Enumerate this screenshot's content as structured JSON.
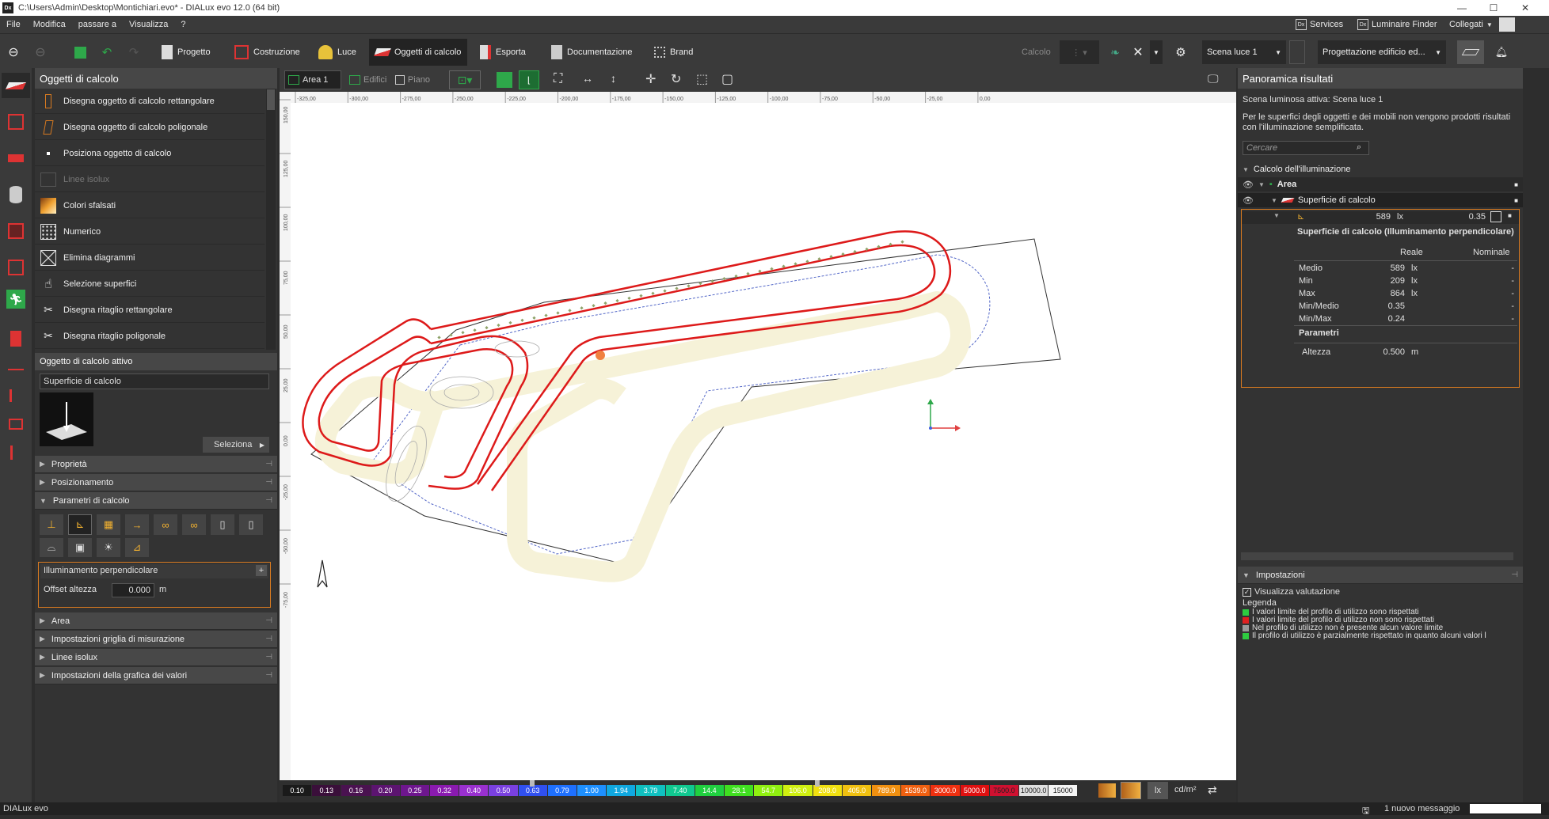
{
  "titlebar": {
    "app_icon": "Dx",
    "title": "C:\\Users\\Admin\\Desktop\\Montichiari.evo* - DIALux evo 12.0  (64 bit)",
    "minimize": "—",
    "maximize": "☐",
    "close": "✕"
  },
  "menu": {
    "items": [
      "File",
      "Modifica",
      "passare a",
      "Visualizza",
      "?"
    ],
    "services": "Services",
    "luminaire_finder": "Luminaire Finder",
    "collegati": "Collegati"
  },
  "toolbar": {
    "tabs": [
      "Progetto",
      "Costruzione",
      "Luce",
      "Oggetti di calcolo",
      "Esporta",
      "Documentazione",
      "Brand"
    ],
    "active_tab": "Oggetti di calcolo",
    "calcolo": "Calcolo",
    "scene": "Scena luce 1",
    "project_mode": "Progettazione edificio ed..."
  },
  "left_panel": {
    "title": "Oggetti di calcolo",
    "tools": [
      "Disegna oggetto di calcolo rettangolare",
      "Disegna oggetto di calcolo poligonale",
      "Posiziona oggetto di calcolo",
      "Linee isolux",
      "Colori sfalsati",
      "Numerico",
      "Elimina diagrammi",
      "Selezione superfici",
      "Disegna ritaglio rettangolare",
      "Disegna ritaglio poligonale"
    ],
    "active_obj_title": "Oggetto di calcolo attivo",
    "active_obj_name": "Superficie di calcolo",
    "select_button": "Seleziona",
    "sections": [
      "Proprietà",
      "Posizionamento",
      "Parametri di calcolo"
    ],
    "calc_type": "Illuminamento perpendicolare",
    "offset_label": "Offset altezza",
    "offset_value": "0.000",
    "offset_unit": "m",
    "bottom_sections": [
      "Area",
      "Impostazioni griglia di misurazione",
      "Linee isolux",
      "Impostazioni della grafica dei valori"
    ]
  },
  "view_tools": {
    "tabs": [
      "Area 1",
      "Edifici",
      "Piano"
    ]
  },
  "ruler": {
    "top": [
      "-325,00",
      "-300,00",
      "-275,00",
      "-250,00",
      "-225,00",
      "-200,00",
      "-175,00",
      "-150,00",
      "-125,00",
      "-100,00",
      "-75,00",
      "-50,00",
      "-25,00",
      "0,00"
    ],
    "left": [
      "150,00",
      "125,00",
      "100,00",
      "75,00",
      "50,00",
      "25,00",
      "0,00",
      "-25,00",
      "-50,00",
      "-75,00"
    ]
  },
  "scale": {
    "values": [
      "0.10",
      "0.13",
      "0.16",
      "0.20",
      "0.25",
      "0.32",
      "0.40",
      "0.50",
      "0.63",
      "0.79",
      "1.00",
      "1.94",
      "3.79",
      "7.40",
      "14.4",
      "28.1",
      "54.7",
      "106.0",
      "208.0",
      "405.0",
      "789.0",
      "1539.0",
      "3000.0",
      "5000.0",
      "7500.0",
      "10000.0",
      "15000"
    ],
    "colors": [
      "#1a1a1a",
      "#3a0f3a",
      "#4a1250",
      "#5c1470",
      "#6e168e",
      "#8a1ab0",
      "#9a30d0",
      "#7a40e0",
      "#3050f0",
      "#1e70ff",
      "#1e90ff",
      "#10a8e0",
      "#10c0c0",
      "#10c890",
      "#20d040",
      "#40e020",
      "#90f010",
      "#d0f010",
      "#f0e010",
      "#f0c010",
      "#f09010",
      "#f06010",
      "#f03010",
      "#e01010",
      "#d01030",
      "#e0e0e0",
      "#f5f5f5"
    ],
    "unit1": "lx",
    "unit2": "cd/m²"
  },
  "right_panel": {
    "title": "Panoramica risultati",
    "scene_active": "Scena luminosa attiva: Scena luce 1",
    "note": "Per le superfici degli oggetti e dei mobili non vengono prodotti risultati con l'illuminazione semplificata.",
    "search_placeholder": "Cercare",
    "tree_root": "Calcolo dell'illuminazione",
    "area": "Area",
    "surface": "Superficie di calcolo",
    "summary_value": "589",
    "summary_unit": "lx",
    "summary_uniformity": "0.35",
    "details_title": "Superficie di calcolo (Illuminamento perpendicolare)",
    "col_real": "Reale",
    "col_nominal": "Nominale",
    "rows": [
      {
        "label": "Medio",
        "value": "589",
        "unit": "lx",
        "nominal": "-"
      },
      {
        "label": "Min",
        "value": "209",
        "unit": "lx",
        "nominal": "-"
      },
      {
        "label": "Max",
        "value": "864",
        "unit": "lx",
        "nominal": "-"
      },
      {
        "label": "Min/Medio",
        "value": "0.35",
        "unit": "",
        "nominal": "-"
      },
      {
        "label": "Min/Max",
        "value": "0.24",
        "unit": "",
        "nominal": "-"
      }
    ],
    "params_title": "Parametri",
    "height_label": "Altezza",
    "height_value": "0.500",
    "height_unit": "m",
    "settings_title": "Impostazioni",
    "show_eval": "Visualizza valutazione",
    "legend_title": "Legenda",
    "legend": [
      {
        "color": "#2ecc40",
        "text": "I valori limite del profilo di utilizzo sono rispettati"
      },
      {
        "color": "#e02020",
        "text": "I valori limite del profilo di utilizzo non sono rispettati"
      },
      {
        "color": "#9a9a9a",
        "text": "Nel profilo di utilizzo non è presente alcun valore limite"
      },
      {
        "color": "#2ecc40",
        "text": "Il profilo di utilizzo è parzialmente rispettato in quanto alcuni valori l"
      }
    ]
  },
  "status": {
    "brand": "DIALux evo",
    "messages": "1 nuovo messaggio"
  }
}
